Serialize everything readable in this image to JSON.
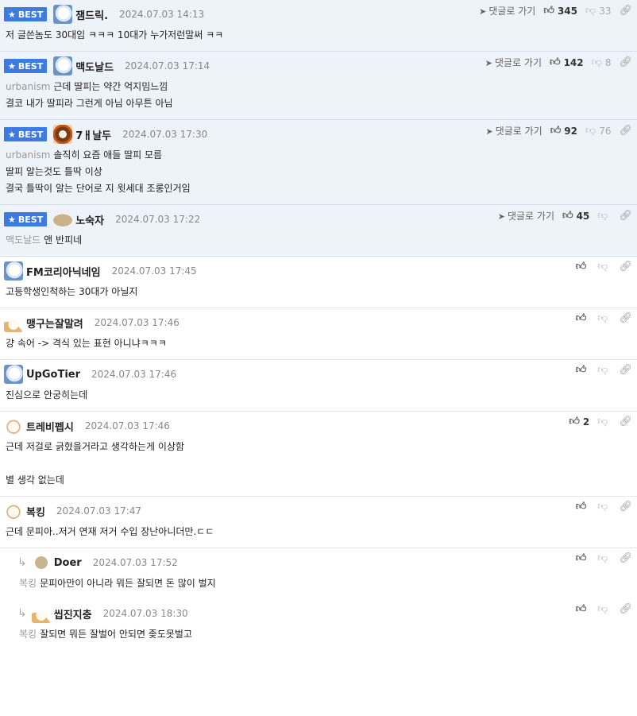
{
  "actions": {
    "goto_label": "댓글로 가기",
    "best_label": "BEST"
  },
  "comments": [
    {
      "type": "best",
      "avatar": "blue",
      "nick": "잼드릭.",
      "date": "2024.07.03 14:13",
      "up": "345",
      "down": "33",
      "mention": "",
      "lines": [
        "저 글쓴놈도 30대임 ㅋㅋㅋ 10대가 누가저런말써 ㅋㅋ"
      ]
    },
    {
      "type": "best",
      "avatar": "blue",
      "nick": "맥도날드",
      "date": "2024.07.03 17:14",
      "up": "142",
      "down": "8",
      "mention": "urbanism",
      "lines": [
        "근데 딸피는 약간 억지밈느낌",
        "결코 내가 딸피라 그런게 아님 아무튼 아님"
      ]
    },
    {
      "type": "best",
      "avatar": "lion",
      "nick": "7ㅐ날두",
      "date": "2024.07.03 17:30",
      "up": "92",
      "down": "76",
      "mention": "urbanism",
      "lines": [
        "솔직히 요즘 애들 딸피 모름",
        "딸피 알는것도 틀딱 이상",
        "결국 틀딱이 알는 단어로 지 윗세대 조롱인거임"
      ]
    },
    {
      "type": "best",
      "avatar": "potato",
      "nick": "노숙자",
      "date": "2024.07.03 17:22",
      "up": "45",
      "down": "",
      "mention": "맥도날드",
      "lines": [
        "앤 반피네"
      ]
    },
    {
      "type": "normal",
      "avatar": "blue",
      "nick": "FM코리아닉네임",
      "date": "2024.07.03 17:45",
      "up": "",
      "down": "",
      "mention": "",
      "lines": [
        "고등학생인척하는 30대가 아닐지"
      ]
    },
    {
      "type": "normal",
      "avatar": "fox",
      "nick": "맹구는잘말려",
      "date": "2024.07.03 17:46",
      "up": "",
      "down": "",
      "mention": "",
      "lines": [
        "걍 속어 -> 격식 있는 표현 아니냐ㅋㅋㅋ"
      ]
    },
    {
      "type": "normal",
      "avatar": "blue",
      "nick": "UpGoTier",
      "date": "2024.07.03 17:46",
      "up": "",
      "down": "",
      "mention": "",
      "lines": [
        "진심으로 안궁히는데"
      ]
    },
    {
      "type": "normal",
      "avatar": "dog",
      "nick": "트레비펩시",
      "date": "2024.07.03 17:46",
      "up": "2",
      "down": "",
      "mention": "",
      "lines": [
        "근데 저걸로 긁혔을거라고 생각하는게 이상함",
        "",
        "별 생각 없는데"
      ]
    },
    {
      "type": "normal",
      "avatar": "dog",
      "nick": "복킹",
      "date": "2024.07.03 17:47",
      "up": "",
      "down": "",
      "mention": "",
      "lines": [
        "근데 문피아..저거 연재 저거 수입 장난아니더만.ㄷㄷ"
      ]
    },
    {
      "type": "reply",
      "avatar": "round",
      "nick": "Doer",
      "date": "2024.07.03 17:52",
      "up": "",
      "down": "",
      "mention": "복킹",
      "lines": [
        "문피아만이 아니라 뭐든 잘되면 돈 많이 벌지"
      ]
    },
    {
      "type": "reply",
      "avatar": "fox",
      "nick": "씹진지충",
      "date": "2024.07.03 18:30",
      "up": "",
      "down": "",
      "mention": "복킹",
      "lines": [
        "잘되면 뭐든 잘벌어 안되면 좆도못벌고"
      ]
    }
  ]
}
